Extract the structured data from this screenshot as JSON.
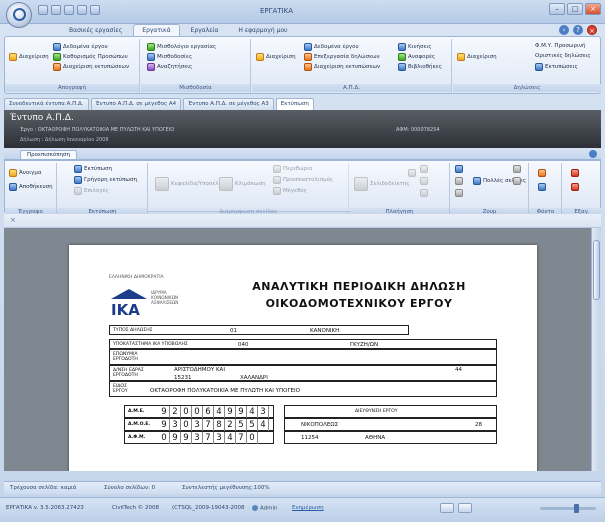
{
  "window": {
    "title": "ΕΡΓΑΤΙΚΑ"
  },
  "ribbon": {
    "tabs": [
      {
        "label": "Βασικές εργασίες"
      },
      {
        "label": "Εργατικά"
      },
      {
        "label": "Εργαλεία"
      },
      {
        "label": "Η εφαρμογή μου"
      }
    ],
    "active_tab": "Εργατικά",
    "groups": [
      {
        "name": "Απογραφή",
        "buttons": [
          "Διαχείριση",
          "Δεδομένα έργου",
          "Καθορισμός Προσώπων",
          "Διαχείριση εκτυπώσεων"
        ]
      },
      {
        "name": "Μισθοδοσία",
        "buttons": [
          "Μισθολόγιο εργασίας",
          "Μισθοδοσίες",
          "Αναζητήσεις"
        ]
      },
      {
        "name": "Α.Π.Δ.",
        "buttons": [
          "Διαχείριση",
          "Δεδομένα έργου",
          "Επεξεργασία δηλώσεων",
          "Διαχείριση εκτυπώσεων",
          "Κινήσεις",
          "Αναφορές",
          "Βιβλιοθήκες"
        ]
      },
      {
        "name": "Δηλώσεις",
        "buttons": [
          "Διαχείριση",
          "Φ.Μ.Υ. Προσωρινή",
          "Οριστικές δηλώσεις",
          "Εκτυπώσεις"
        ]
      }
    ]
  },
  "doc_tabs": [
    {
      "label": "Συνοδευτικά έντυπα Α.Π.Δ."
    },
    {
      "label": "Έντυπο Α.Π.Δ. σε μέγεθος Α4"
    },
    {
      "label": "Έντυπο Α.Π.Δ. σε μέγεθος Α3"
    },
    {
      "label": "Εκτύπωση"
    }
  ],
  "banner": {
    "title": "Έντυπο Α.Π.Δ.",
    "project": "Έργο : ΟΚΤΑΟΡΟΦΗ ΠΟΛΥΚΑΤΟΙΚΙΑ ΜΕ ΠΥΛΩΤΗ ΚΑΙ ΥΠΟΓΕΙΟ",
    "afm": "ΑΦΜ: 000078254",
    "period": "Δήλωση : Δήλωση Ιανουαρίου 2008"
  },
  "print_ribbon": {
    "tab": "Προεπισκόπηση",
    "groups": [
      {
        "name": "Έγγραφο",
        "buttons": [
          "Άνοιγμα",
          "Αποθήκευση"
        ]
      },
      {
        "name": "Εκτύπωση",
        "buttons": [
          "Εκτύπωση",
          "Γρήγορη εκτύπωση",
          "Επιλογές"
        ]
      },
      {
        "name": "Διαμόρφωση σελίδας",
        "buttons": [
          "Κεφαλίδα/Υποσέλιδο",
          "Κλιμάκωση",
          "Περιθώρια",
          "Προσανατολισμός",
          "Μέγεθος"
        ]
      },
      {
        "name": "Πλοήγηση",
        "buttons": [
          "Σελιδοδείκτης"
        ]
      },
      {
        "name": "Ζουμ",
        "buttons": [
          "Πολλές σελίδες"
        ]
      },
      {
        "name": "Φόντο",
        "buttons": []
      },
      {
        "name": "Εξαγ.",
        "buttons": []
      }
    ]
  },
  "document": {
    "org": "ΕΛΛΗΝΙΚΗ ΔΗΜΟΚΡΑΤΙΑ",
    "logo_text": "ΙΚΑ",
    "org_lines": [
      "ΙΔΡΥΜΑ",
      "ΚΟΙΝΩΝΙΚΩΝ",
      "ΑΣΦΑΛΙΣΕΩΝ"
    ],
    "title_line1": "ΑΝΑΛΥΤΙΚΗ ΠΕΡΙΟΔΙΚΗ ΔΗΛΩΣΗ",
    "title_line2": "ΟΙΚΟΔΟΜΟΤΕΧΝΙΚΟΥ ΕΡΓΟΥ",
    "type_label": "ΤΥΠΟΣ ΔΗΛΩΣΗΣ",
    "type_value": "01",
    "type_desc": "ΚΑΝΟΝΙΚΗ",
    "branch_label": "ΥΠΟΚΑΤΑΣΤΗΜΑ ΙΚΑ ΥΠΟΒΟΛΗΣ",
    "branch_code": "040",
    "branch_name": "ΓΚΥΖΗ/ΩΝ",
    "employer_label": "ΕΠΩΝΥΜΙΑ ΕΡΓΟΔΟΤΗ",
    "address_label": "Δ/ΝΣΗ ΕΔΡΑΣ ΕΡΓΟΔΟΤΗ",
    "street": "ΑΡΙΣΤΟΔΗΜΟΥ ΚΑΙ",
    "street_no": "44",
    "postal": "15231",
    "city": "ΧΑΛΑΝΔΡΙ",
    "project_label": "ΕΙΔΟΣ ΕΡΓΟΥ",
    "project_value": "ΟΚΤΑΟΡΟΦΗ ΠΟΛΥΚΑΤΟΙΚΙΑ ΜΕ ΠΥΛΩΤΗ ΚΑΙ ΥΠΟΓΕΙΟ",
    "ame_label": "Α.Μ.Ε.",
    "ame_digits": [
      "9",
      "2",
      "0",
      "0",
      "6",
      "4",
      "9",
      "9",
      "4",
      "3"
    ],
    "amoe_label": "Α.Μ.Ο.Ε.",
    "amoe_digits": [
      "9",
      "3",
      "0",
      "3",
      "7",
      "8",
      "2",
      "5",
      "5",
      "4"
    ],
    "afm_label": "Α.Φ.Μ.",
    "afm_digits": [
      "0",
      "9",
      "9",
      "3",
      "7",
      "3",
      "4",
      "7",
      "0"
    ],
    "site_label": "ΔΙΕΥΘΥΝΣΗ ΕΡΓΟΥ",
    "site_street": "ΝΙΚΟΠΟΛΕΩΣ",
    "site_no": "28",
    "site_postal": "11254",
    "site_city": "ΑΘΗΝΑ"
  },
  "statusbar": {
    "page": "Τρέχουσα σελίδα: καμιά",
    "total": "Σύνολο σελίδων: 0",
    "zoom": "Συντελεστής μεγέθυνσης:100%"
  },
  "taskbar": {
    "app_version": "ΕΡΓΑΤΙΚΑ v. 3.5.2063.27423",
    "copyright": "CivilTech © 2008",
    "db": "(CTSQL_2009-19043-2008",
    "user": "Admin",
    "sync": "Ενημέρωση"
  }
}
